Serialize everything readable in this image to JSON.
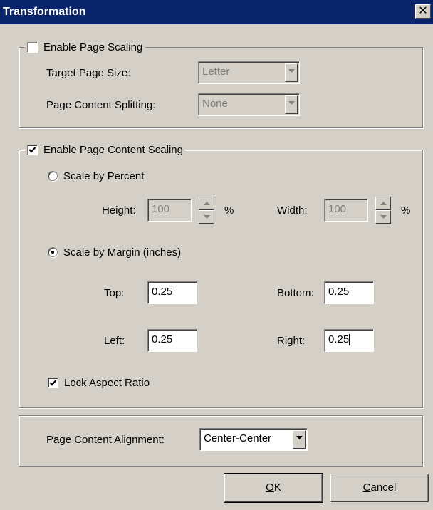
{
  "window": {
    "title": "Transformation",
    "close_glyph": "✕"
  },
  "page_scaling": {
    "label": "Enable Page Scaling",
    "checked": false,
    "target_size_label": "Target Page Size:",
    "target_size_value": "Letter",
    "splitting_label": "Page Content Splitting:",
    "splitting_value": "None"
  },
  "content_scaling": {
    "label": "Enable Page Content Scaling",
    "checked": true,
    "percent_label": "Scale by Percent",
    "height_label": "Height:",
    "height_value": "100",
    "width_label": "Width:",
    "width_value": "100",
    "percent_sign": "%",
    "margin_label": "Scale by Margin (inches)",
    "top_label": "Top:",
    "top_value": "0.25",
    "bottom_label": "Bottom:",
    "bottom_value": "0.25",
    "left_label": "Left:",
    "left_value": "0.25",
    "right_label": "Right:",
    "right_value": "0.25",
    "lock_label": "Lock Aspect Ratio"
  },
  "alignment": {
    "label": "Page Content Alignment:",
    "value": "Center-Center"
  },
  "buttons": {
    "ok_mnemonic": "O",
    "ok_rest": "K",
    "cancel_mnemonic": "C",
    "cancel_rest": "ancel"
  }
}
